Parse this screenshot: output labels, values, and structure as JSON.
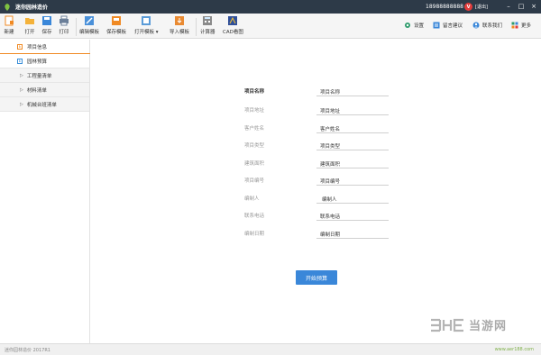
{
  "titlebar": {
    "app_title": "迷你园林造价",
    "phone": "18988888888",
    "vip_badge": "V",
    "logout": "[退出]"
  },
  "toolbar": {
    "buttons": [
      {
        "label": "新建",
        "icon": "new-file-icon"
      },
      {
        "label": "打开",
        "icon": "open-folder-icon"
      },
      {
        "label": "保存",
        "icon": "save-icon"
      },
      {
        "label": "打印",
        "icon": "print-icon"
      },
      {
        "label": "编辑模板",
        "icon": "edit-template-icon"
      },
      {
        "label": "保存模板",
        "icon": "save-template-icon"
      },
      {
        "label": "打开模板 ▾",
        "icon": "open-template-icon"
      },
      {
        "label": "导入模板",
        "icon": "import-template-icon"
      },
      {
        "label": "计算器",
        "icon": "calculator-icon"
      },
      {
        "label": "CAD看图",
        "icon": "cad-viewer-icon"
      }
    ],
    "right": [
      {
        "label": "设置",
        "icon": "gear-icon"
      },
      {
        "label": "留言建议",
        "icon": "feedback-icon"
      },
      {
        "label": "联系我们",
        "icon": "contact-icon"
      },
      {
        "label": "更多",
        "icon": "more-icon"
      }
    ]
  },
  "sidebar": {
    "items": [
      {
        "label": "项目信息",
        "icon_char": "E"
      },
      {
        "label": "园林预算",
        "icon_char": "E"
      },
      {
        "label": "工程量清单"
      },
      {
        "label": "材料清单"
      },
      {
        "label": "机械台班清单"
      }
    ]
  },
  "form": {
    "fields": [
      {
        "label": "项目名称",
        "value": "项目名称"
      },
      {
        "label": "项目地址",
        "value": "项目地址"
      },
      {
        "label": "客户姓名",
        "value": "客户姓名"
      },
      {
        "label": "项目类型",
        "value": "项目类型"
      },
      {
        "label": "建筑面积",
        "value": "建筑面积"
      },
      {
        "label": "项目编号",
        "value": "项目编号"
      },
      {
        "label": "编制人",
        "value": "编制人"
      },
      {
        "label": "联系电话",
        "value": "联系电话"
      },
      {
        "label": "编制日期",
        "value": "编制日期"
      }
    ],
    "start_button": "开始预算"
  },
  "statusbar": {
    "status_text": "迷你园林造价  2017R1",
    "site": "www.aer188.com"
  },
  "watermark": {
    "text": "当游网"
  },
  "colors": {
    "titlebar": "#2d3a48",
    "accent_orange": "#f08a24",
    "button_blue": "#3a87d9"
  }
}
